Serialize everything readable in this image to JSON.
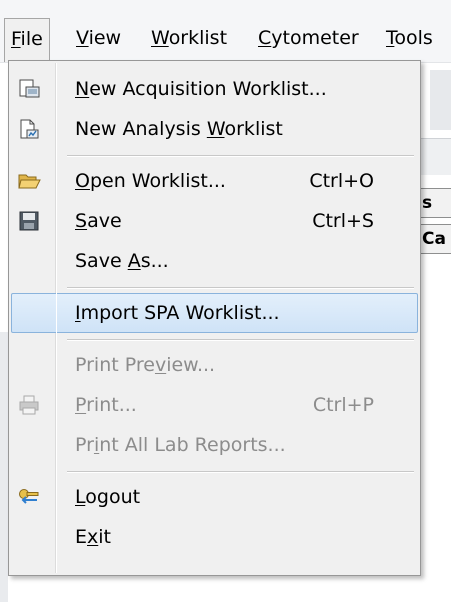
{
  "menubar": {
    "items": [
      {
        "id": "file",
        "label": "File",
        "mnemonic": "F",
        "rest": "ile"
      },
      {
        "id": "view",
        "label": "View",
        "mnemonic": "V",
        "rest": "iew"
      },
      {
        "id": "worklist",
        "label": "Worklist",
        "mnemonic": "W",
        "rest": "orklist"
      },
      {
        "id": "cytometer",
        "label": "Cytometer",
        "mnemonic": "C",
        "rest": "ytometer"
      },
      {
        "id": "tools",
        "label": "Tools",
        "mnemonic": "T",
        "rest": "ools"
      }
    ]
  },
  "background": {
    "partial_label_1": "s",
    "partial_label_2": "Ca"
  },
  "file_menu": {
    "new_acquisition": {
      "pre": "",
      "mn": "N",
      "post": "ew Acquisition Worklist...",
      "icon": "new-acquisition-worklist-icon"
    },
    "new_analysis": {
      "pre": "New Analysis ",
      "mn": "W",
      "post": "orklist",
      "icon": "new-analysis-worklist-icon"
    },
    "open": {
      "pre": "",
      "mn": "O",
      "post": "pen Worklist...",
      "shortcut": "Ctrl+O",
      "icon": "open-folder-icon"
    },
    "save": {
      "pre": "",
      "mn": "S",
      "post": "ave",
      "shortcut": "Ctrl+S",
      "icon": "save-disk-icon"
    },
    "save_as": {
      "pre": "Save ",
      "mn": "A",
      "post": "s..."
    },
    "import_spa": {
      "pre": "",
      "mn": "I",
      "post": "mport SPA Worklist...",
      "highlighted": true
    },
    "print_preview": {
      "pre": "Print Pre",
      "mn": "v",
      "post": "iew...",
      "disabled": true
    },
    "print": {
      "pre": "",
      "mn": "P",
      "post": "rint...",
      "shortcut": "Ctrl+P",
      "disabled": true,
      "icon": "printer-icon"
    },
    "print_all": {
      "pre": "Pr",
      "mn": "i",
      "post": "nt All Lab Reports...",
      "disabled": true
    },
    "logout": {
      "pre": "",
      "mn": "L",
      "post": "ogout",
      "icon": "logout-key-icon"
    },
    "exit": {
      "pre": "E",
      "mn": "x",
      "post": "it"
    }
  },
  "colors": {
    "highlight_border": "#8ab3dc",
    "highlight_fill": "#cfe3f7",
    "disabled_text": "#8c8c8c",
    "menu_bg": "#f0f0f0"
  }
}
